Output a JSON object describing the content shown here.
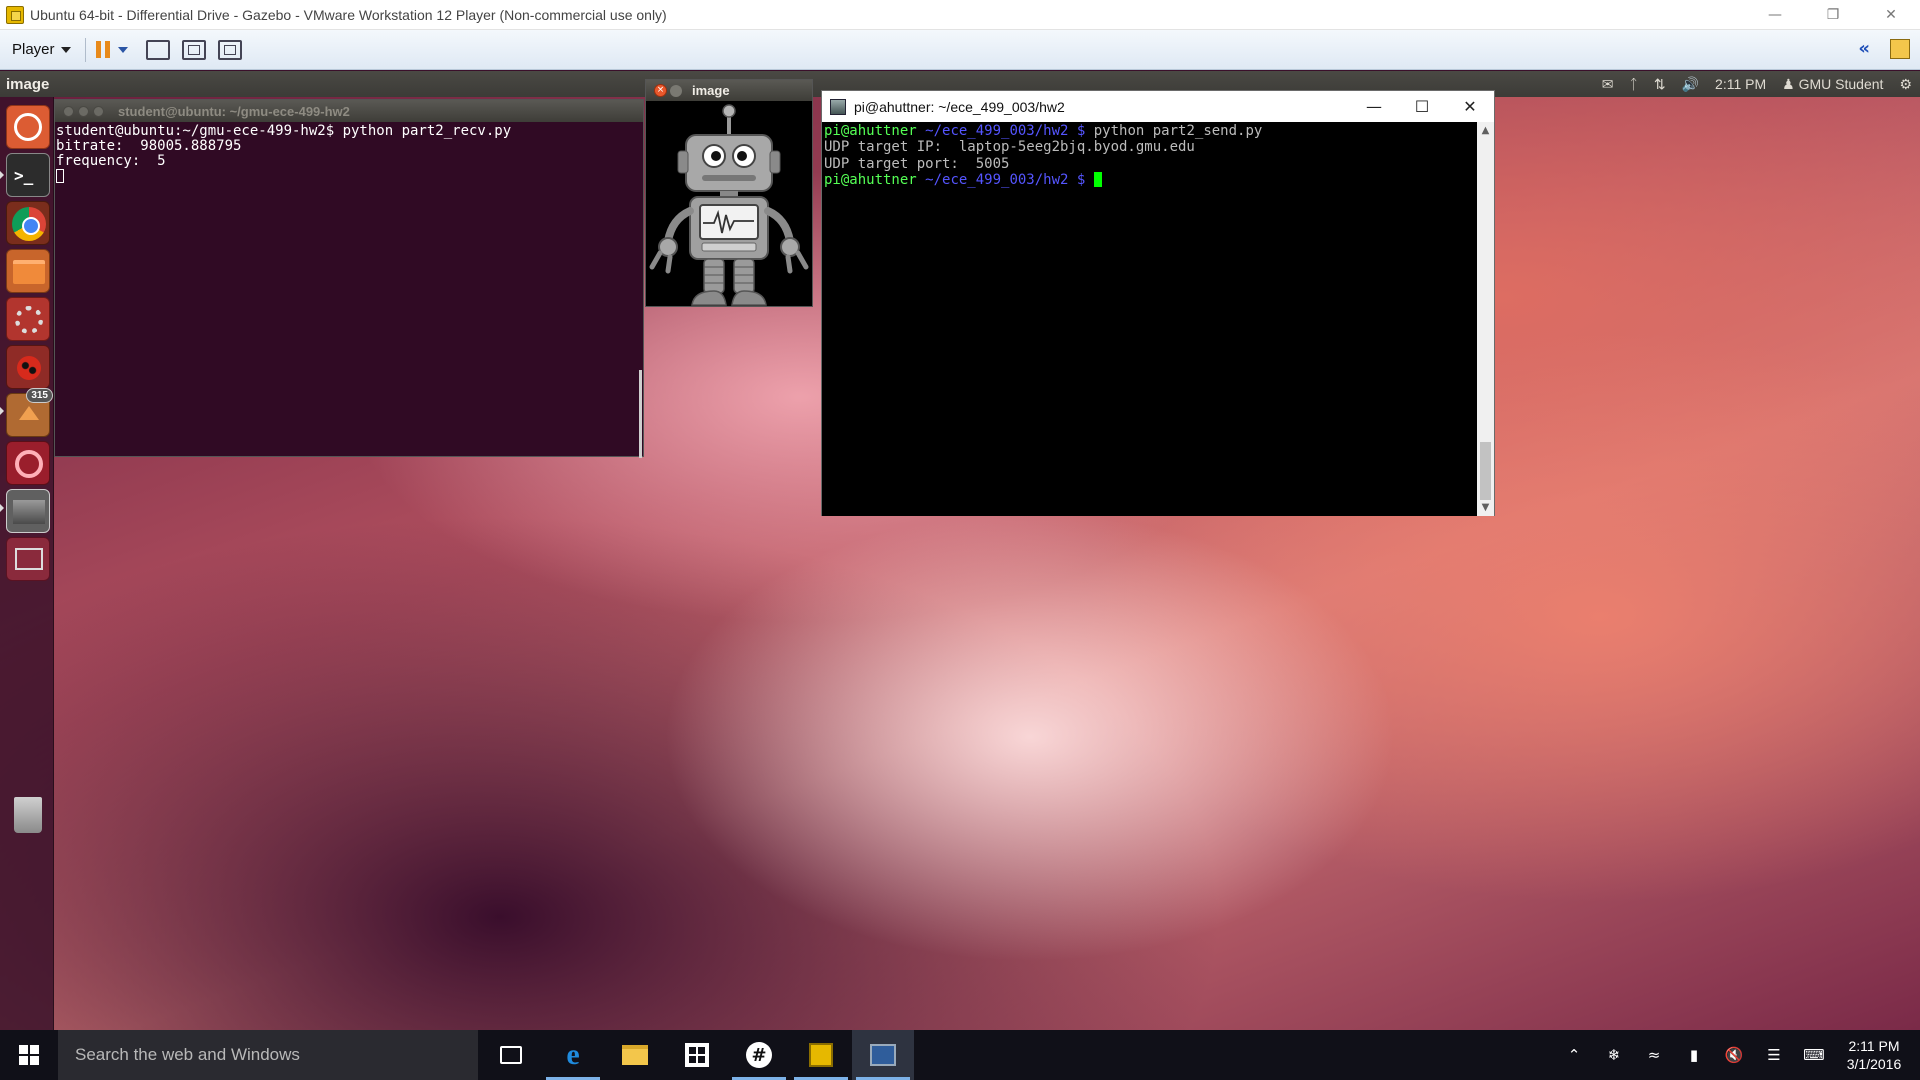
{
  "vmware": {
    "window_title": "Ubuntu 64-bit - Differential Drive - Gazebo - VMware Workstation 12 Player (Non-commercial use only)",
    "toolbar": {
      "player_menu": "Player"
    }
  },
  "ubuntu_panel": {
    "active_app": "image",
    "time": "2:11 PM",
    "user": "GMU Student"
  },
  "launcher": {
    "items": [
      "dash",
      "terminal",
      "chrome",
      "files",
      "settings",
      "bug-report",
      "software-updater",
      "software-center",
      "gazebo",
      "workspaces",
      "trash"
    ],
    "updater_badge": "315"
  },
  "terminal_ubuntu": {
    "title": "student@ubuntu: ~/gmu-ece-499-hw2",
    "lines": [
      "student@ubuntu:~/gmu-ece-499-hw2$ python part2_recv.py",
      "bitrate:  98005.888795",
      "frequency:  5"
    ]
  },
  "image_window": {
    "title": "image"
  },
  "putty": {
    "title": "pi@ahuttner: ~/ece_499_003/hw2",
    "prompt_user": "pi@ahuttner",
    "prompt_path": "~/ece_499_003/hw2 $",
    "command": "python part2_send.py",
    "output": [
      "UDP target IP:  laptop-5eeg2bjq.byod.gmu.edu",
      "UDP target port:  5005"
    ]
  },
  "taskbar": {
    "search_placeholder": "Search the web and Windows",
    "time": "2:11 PM",
    "date": "3/1/2016"
  },
  "colors": {
    "ubuntu_terminal_bg": "#300a24",
    "putty_prompt_green": "#55ff55",
    "putty_path_blue": "#5555ff",
    "putty_cursor": "#00ff00",
    "ubuntu_dash": "#dc5c33"
  }
}
